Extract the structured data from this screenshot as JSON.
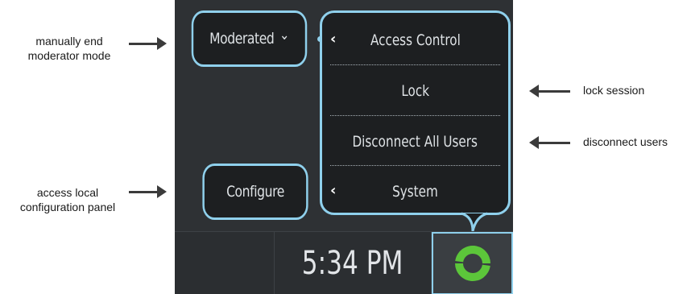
{
  "annotations": {
    "end_moderator_line1": "manually end",
    "end_moderator_line2": "moderator mode",
    "local_config_line1": "access local",
    "local_config_line2": "configuration panel",
    "lock_session": "lock session",
    "disconnect_users": "disconnect users"
  },
  "panel": {
    "moderated_label": "Moderated",
    "moderated_chevron": "⌄",
    "configure_label": "Configure",
    "menu_items": [
      {
        "label": "Access Control",
        "chevron": "‹"
      },
      {
        "label": "Lock",
        "chevron": ""
      },
      {
        "label": "Disconnect All Users",
        "chevron": ""
      },
      {
        "label": "System",
        "chevron": "‹"
      }
    ],
    "time": "5:34 PM",
    "logo_icon": "green-swirl-logo-icon"
  },
  "colors": {
    "accent_outline": "#8fd0ec",
    "button_fill": "#1d1f21",
    "screen_bg": "#2e3134",
    "logo_green": "#5cc63a"
  }
}
